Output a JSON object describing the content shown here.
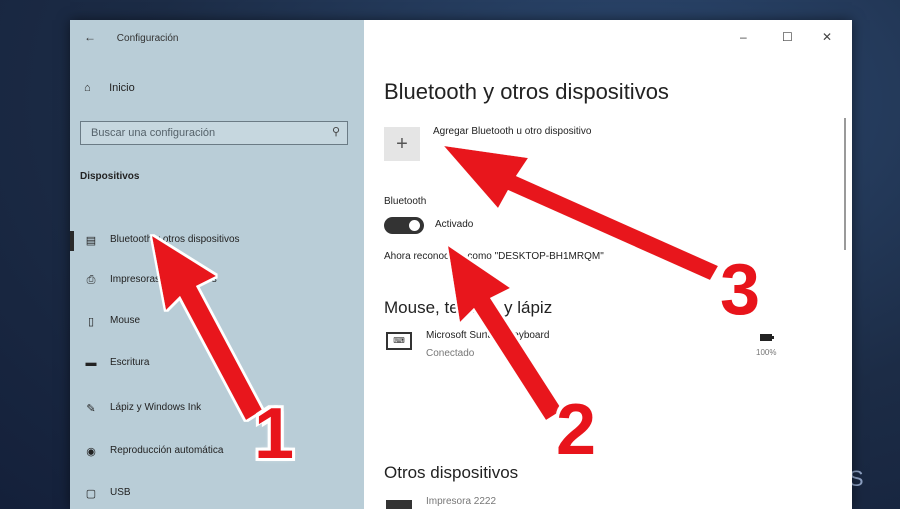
{
  "window": {
    "title": "Configuración",
    "controls": {
      "minimize": "–",
      "maximize": "☐",
      "close": "✕"
    }
  },
  "sidebar": {
    "home": "Inicio",
    "search": {
      "placeholder": "Buscar una configuración",
      "icon": "search-icon"
    },
    "heading": "Dispositivos",
    "items": [
      {
        "label": "Bluetooth y otros dispositivos",
        "icon": "bluetooth-devices-icon",
        "active": true
      },
      {
        "label": "Impresoras y escáneres",
        "icon": "printer-icon"
      },
      {
        "label": "Mouse",
        "icon": "mouse-icon"
      },
      {
        "label": "Escritura",
        "icon": "keyboard-icon"
      },
      {
        "label": "Lápiz y Windows Ink",
        "icon": "pen-icon"
      },
      {
        "label": "Reproducción automática",
        "icon": "autoplay-icon"
      },
      {
        "label": "USB",
        "icon": "usb-icon"
      }
    ]
  },
  "main": {
    "title": "Bluetooth y otros dispositivos",
    "add_label": "Agregar Bluetooth u otro dispositivo",
    "bluetooth": {
      "section_label": "Bluetooth",
      "toggle_state": "Activado",
      "discoverable": "Ahora reconocible como \"DESKTOP-BH1MRQM\""
    },
    "mouse_section": {
      "heading": "Mouse, teclado y lápiz",
      "device": {
        "name": "Microsoft Surface Keyboard",
        "status": "Conectado",
        "battery": "100%"
      }
    },
    "other_section": {
      "heading": "Otros dispositivos",
      "device": {
        "name": "Impresora 2222"
      }
    }
  },
  "annotations": {
    "arrow_1": "1",
    "arrow_2": "2",
    "arrow_3": "3"
  },
  "colors": {
    "sidebar_bg": "#b9cdd7",
    "arrow_red": "#e8141b",
    "background": "#1c2c46"
  },
  "watermark": "CS"
}
